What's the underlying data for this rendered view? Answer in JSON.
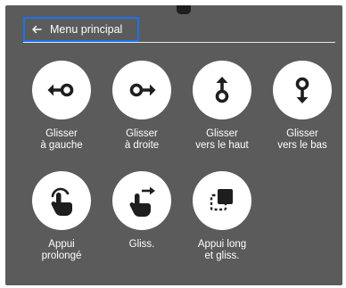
{
  "header": {
    "title": "Menu principal",
    "back_icon": "arrow-left-icon",
    "highlight_color": "#1a73e8"
  },
  "colors": {
    "background": "#5b5b5b",
    "text": "#ffffff",
    "icon_circle": "#ffffff",
    "icon_glyph": "#1e1e1e"
  },
  "actions": [
    {
      "label": "Glisser\nà gauche",
      "icon": "swipe-left-icon"
    },
    {
      "label": "Glisser\nà droite",
      "icon": "swipe-right-icon"
    },
    {
      "label": "Glisser\nvers le haut",
      "icon": "swipe-up-icon"
    },
    {
      "label": "Glisser\nvers le bas",
      "icon": "swipe-down-icon"
    },
    {
      "label": "Appui\nprolongé",
      "icon": "long-press-icon"
    },
    {
      "label": "Gliss.",
      "icon": "drag-icon"
    },
    {
      "label": "Appui long\net gliss.",
      "icon": "long-press-drag-icon"
    }
  ]
}
